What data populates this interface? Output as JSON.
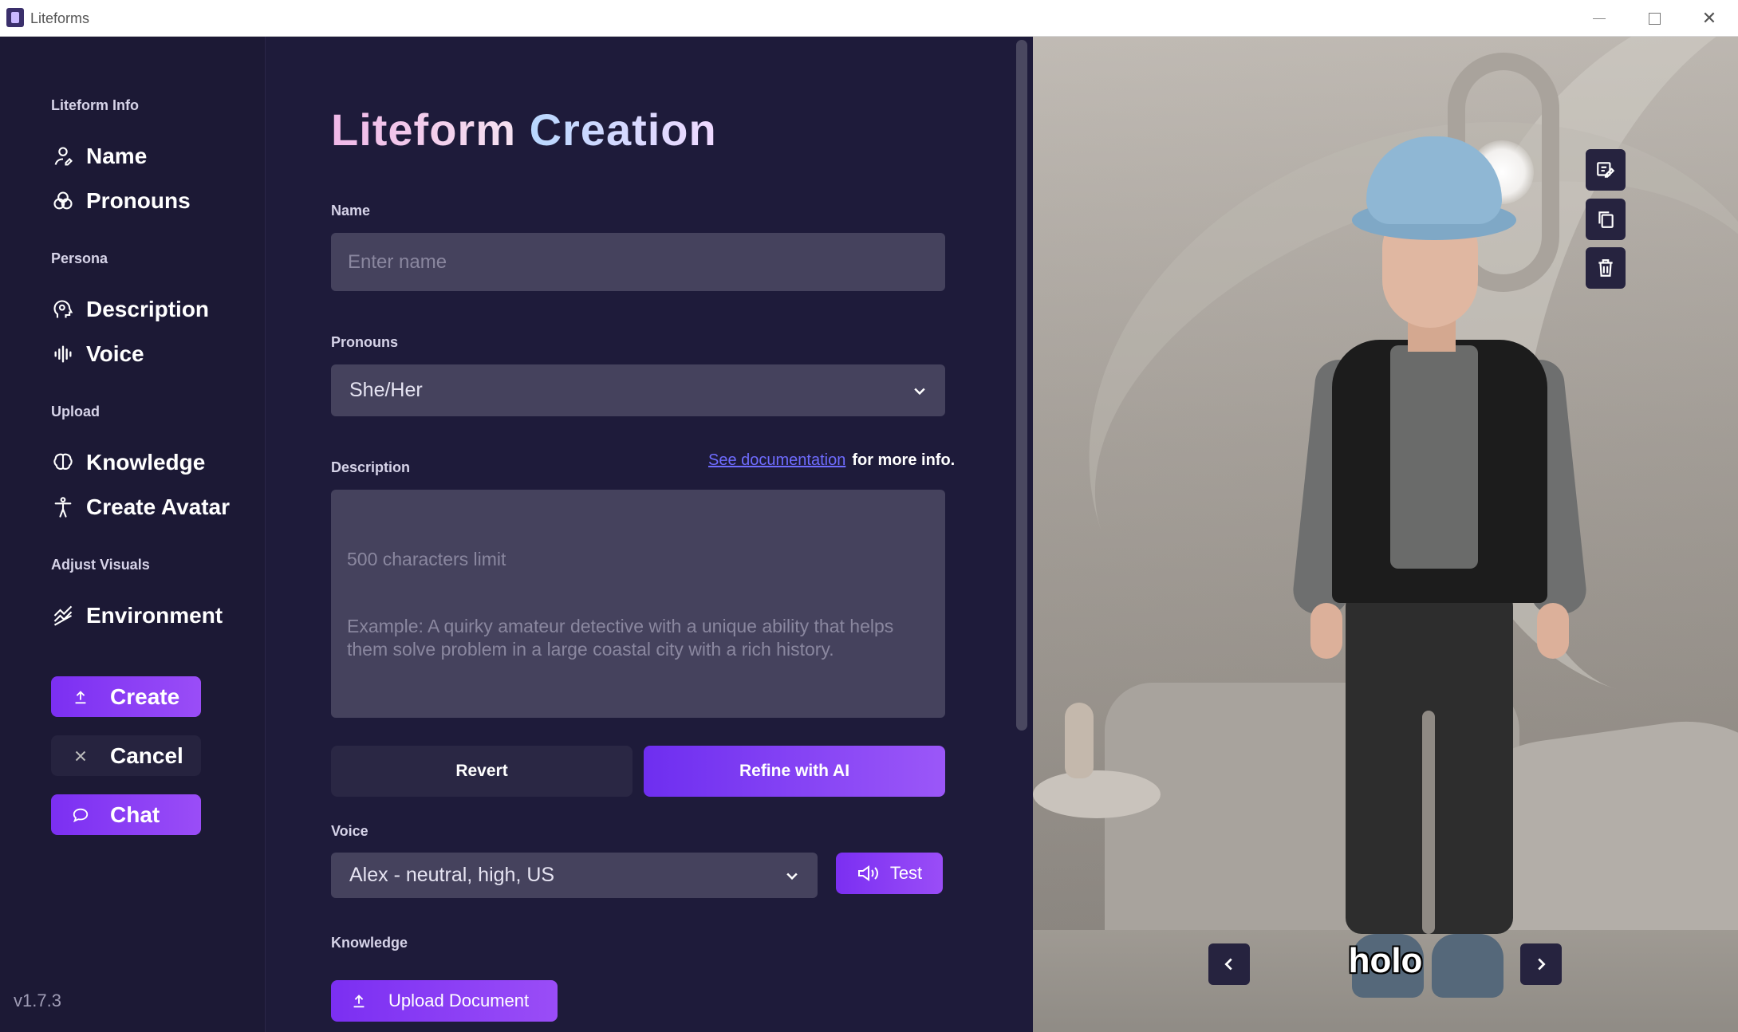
{
  "window": {
    "title": "Liteforms",
    "minimize_label": "",
    "maximize_label": "",
    "close_label": "✕"
  },
  "sidebar": {
    "sections": {
      "info": "Liteform Info",
      "persona": "Persona",
      "upload": "Upload",
      "visuals": "Adjust Visuals"
    },
    "items": {
      "name": "Name",
      "pronouns": "Pronouns",
      "description": "Description",
      "voice": "Voice",
      "knowledge": "Knowledge",
      "create_avatar": "Create Avatar",
      "environment": "Environment"
    },
    "buttons": {
      "create": "Create",
      "cancel": "Cancel",
      "chat": "Chat"
    },
    "version": "v1.7.3"
  },
  "form": {
    "title_part1": "Liteform",
    "title_part2": "Creation",
    "name_label": "Name",
    "name_placeholder": "Enter name",
    "name_value": "",
    "pronouns_label": "Pronouns",
    "pronouns_value": "She/Her",
    "description_label": "Description",
    "doc_link": "See documentation",
    "doc_suffix": "for more info.",
    "description_limit": "500 characters limit",
    "description_example": "Example: A quirky amateur detective with a unique ability that helps them solve problem in a large coastal city with a rich history.",
    "revert_button": "Revert",
    "refine_button": "Refine with AI",
    "voice_label": "Voice",
    "voice_value": "Alex - neutral, high, US",
    "test_button": "Test",
    "knowledge_label": "Knowledge",
    "upload_button": "Upload Document"
  },
  "preview": {
    "avatar_name": "holo",
    "tools": [
      "edit-icon",
      "copy-icon",
      "trash-icon"
    ]
  },
  "colors": {
    "accent": "#7b2ff2",
    "background": "#1e1b3a",
    "sidebar": "#1c1935",
    "input": "#45425d",
    "link": "#6f6cff"
  }
}
